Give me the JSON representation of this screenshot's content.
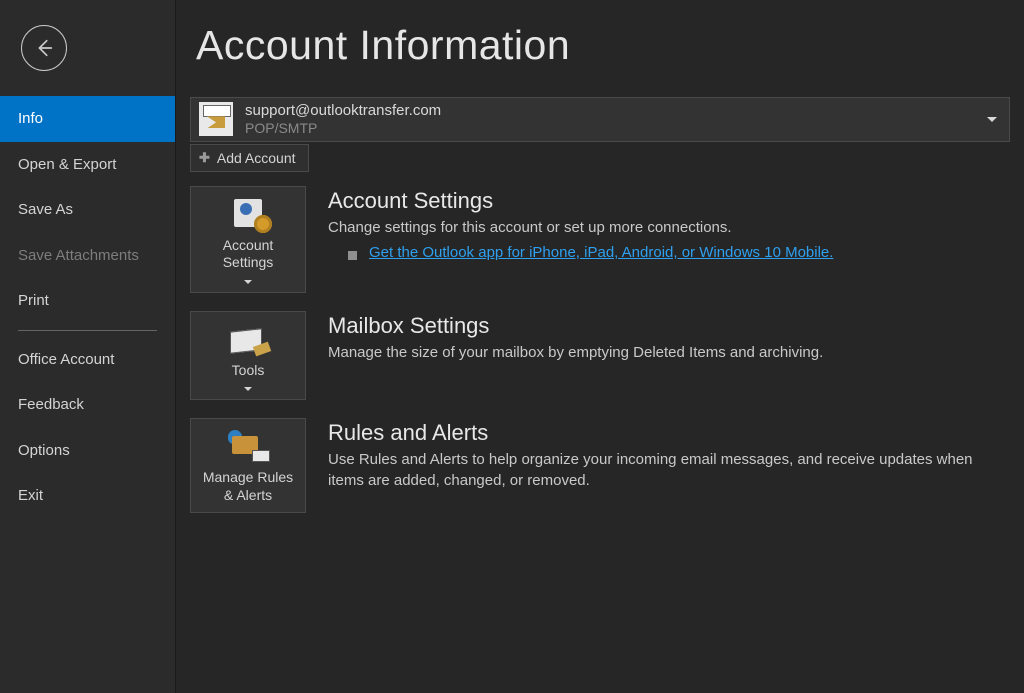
{
  "sidebar": {
    "items": [
      {
        "label": "Info",
        "state": "active"
      },
      {
        "label": "Open & Export",
        "state": "normal"
      },
      {
        "label": "Save As",
        "state": "normal"
      },
      {
        "label": "Save Attachments",
        "state": "disabled"
      },
      {
        "label": "Print",
        "state": "normal"
      },
      {
        "label": "Office Account",
        "state": "normal"
      },
      {
        "label": "Feedback",
        "state": "normal"
      },
      {
        "label": "Options",
        "state": "normal"
      },
      {
        "label": "Exit",
        "state": "normal"
      }
    ]
  },
  "header": {
    "title": "Account Information"
  },
  "account_selector": {
    "email": "support@outlooktransfer.com",
    "type": "POP/SMTP"
  },
  "add_account_label": "Add Account",
  "sections": {
    "account_settings": {
      "tile_label": "Account Settings",
      "title": "Account Settings",
      "desc": "Change settings for this account or set up more connections.",
      "link": "Get the Outlook app for iPhone, iPad, Android, or Windows 10 Mobile."
    },
    "mailbox_settings": {
      "tile_label": "Tools",
      "title": "Mailbox Settings",
      "desc": "Manage the size of your mailbox by emptying Deleted Items and archiving."
    },
    "rules_alerts": {
      "tile_label": "Manage Rules & Alerts",
      "title": "Rules and Alerts",
      "desc": "Use Rules and Alerts to help organize your incoming email messages, and receive updates when items are added, changed, or removed."
    }
  }
}
